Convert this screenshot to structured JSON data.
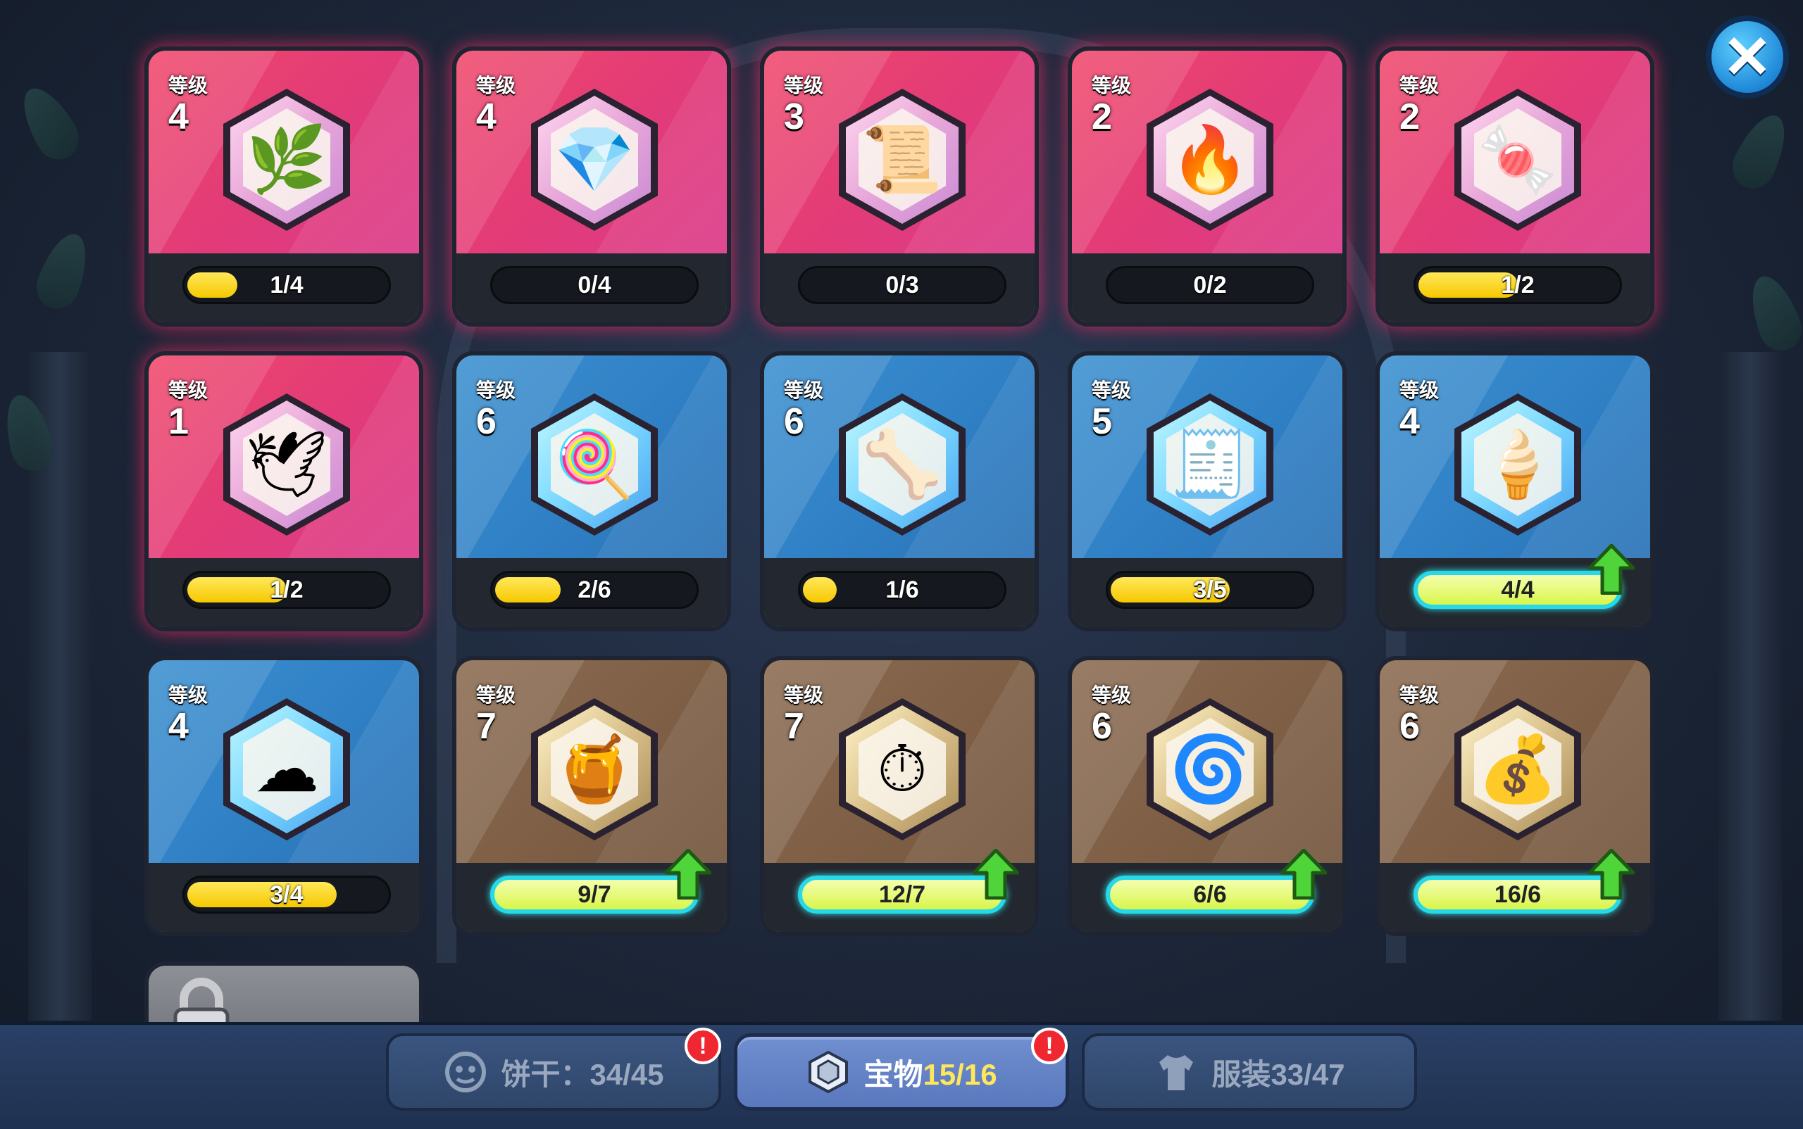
{
  "level_label": "等级",
  "close_label": "✕",
  "treasures": [
    {
      "name": "teal-branch",
      "level": "4",
      "progress": "1/4",
      "fraction": 0.25,
      "rarity": "red",
      "glyph": "🌿",
      "ready": false
    },
    {
      "name": "blue-bag",
      "level": "4",
      "progress": "0/4",
      "fraction": 0,
      "rarity": "red",
      "glyph": "💎",
      "ready": false
    },
    {
      "name": "scroll",
      "level": "3",
      "progress": "0/3",
      "fraction": 0,
      "rarity": "red",
      "glyph": "📜",
      "ready": false
    },
    {
      "name": "fire-crown",
      "level": "2",
      "progress": "0/2",
      "fraction": 0,
      "rarity": "red",
      "glyph": "🔥",
      "ready": false
    },
    {
      "name": "slime-pet",
      "level": "2",
      "progress": "1/2",
      "fraction": 0.5,
      "rarity": "red",
      "glyph": "🍬",
      "ready": false
    },
    {
      "name": "white-wing",
      "level": "1",
      "progress": "1/2",
      "fraction": 0.5,
      "rarity": "red",
      "glyph": "🕊",
      "ready": false
    },
    {
      "name": "bear-candy",
      "level": "6",
      "progress": "2/6",
      "fraction": 0.33,
      "rarity": "blue",
      "glyph": "🍭",
      "ready": false
    },
    {
      "name": "bone-scythe",
      "level": "6",
      "progress": "1/6",
      "fraction": 0.17,
      "rarity": "blue",
      "glyph": "🦴",
      "ready": false
    },
    {
      "name": "pink-scroll",
      "level": "5",
      "progress": "3/5",
      "fraction": 0.6,
      "rarity": "blue",
      "glyph": "🧾",
      "ready": false
    },
    {
      "name": "ice-cream-horn",
      "level": "4",
      "progress": "4/4",
      "fraction": 1,
      "rarity": "blue",
      "glyph": "🍦",
      "ready": true
    },
    {
      "name": "cotton-candy",
      "level": "4",
      "progress": "3/4",
      "fraction": 0.75,
      "rarity": "blue",
      "glyph": "☁",
      "ready": false
    },
    {
      "name": "orange-pot",
      "level": "7",
      "progress": "9/7",
      "fraction": 1,
      "rarity": "brown",
      "glyph": "🍯",
      "ready": true
    },
    {
      "name": "pocket-watch",
      "level": "7",
      "progress": "12/7",
      "fraction": 1,
      "rarity": "brown",
      "glyph": "⏱",
      "ready": true
    },
    {
      "name": "purple-swirl",
      "level": "6",
      "progress": "6/6",
      "fraction": 1,
      "rarity": "brown",
      "glyph": "🌀",
      "ready": true
    },
    {
      "name": "treasure-chest",
      "level": "6",
      "progress": "16/6",
      "fraction": 1,
      "rarity": "brown",
      "glyph": "💰",
      "ready": true
    }
  ],
  "tabs": {
    "cookies": {
      "label": "饼干：34/45",
      "alert": "!"
    },
    "treasures": {
      "label": "宝物",
      "count": "15/16",
      "alert": "!"
    },
    "costumes": {
      "label": "服装33/47"
    }
  },
  "colors": {
    "red": "#e23b78",
    "blue": "#2f7fc4",
    "brown": "#7d5e45",
    "accent": "#ffe75a"
  }
}
